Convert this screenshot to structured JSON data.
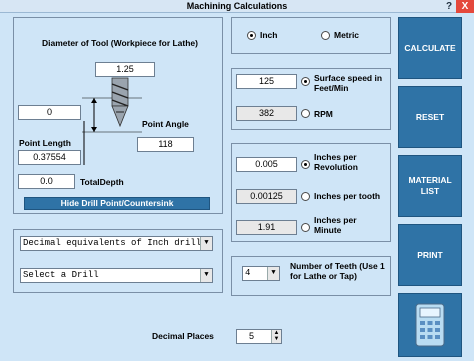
{
  "window": {
    "title": "Machining Calculations",
    "help": "?",
    "close": "X"
  },
  "tool": {
    "diameter_label": "Diameter of Tool (Workpiece for Lathe)",
    "diameter_value": "1.25",
    "left_value": "0",
    "point_angle_label": "Point Angle",
    "point_angle_value": "118",
    "point_length_label": "Point Length",
    "point_length_value": "0.37554",
    "total_depth_value": "0.0",
    "total_depth_label": "TotalDepth",
    "hide_button": "Hide Drill Point/Countersink"
  },
  "units": {
    "inch": "Inch",
    "metric": "Metric",
    "selected": "inch"
  },
  "speed": {
    "surface_value": "125",
    "surface_label": "Surface speed in Feet/Min",
    "rpm_value": "382",
    "rpm_label": "RPM"
  },
  "feed": {
    "per_rev_value": "0.005",
    "per_rev_label": "Inches per Revolution",
    "per_tooth_value": "0.00125",
    "per_tooth_label": "Inches per tooth",
    "per_min_value": "1.91",
    "per_min_label": "Inches per Minute"
  },
  "teeth": {
    "value": "4",
    "label": "Number of Teeth (Use 1 for Lathe or Tap)"
  },
  "drill": {
    "equivalents_select": "Decimal equivalents of Inch drill",
    "drill_select": "Select a Drill"
  },
  "decimals": {
    "label": "Decimal Places",
    "value": "5"
  },
  "buttons": {
    "calculate": "CALCULATE",
    "reset": "RESET",
    "material": "MATERIAL LIST",
    "print": "PRINT"
  },
  "colors": {
    "accent": "#2f73a6",
    "background": "#cfe5f7",
    "close": "#e4483c"
  }
}
